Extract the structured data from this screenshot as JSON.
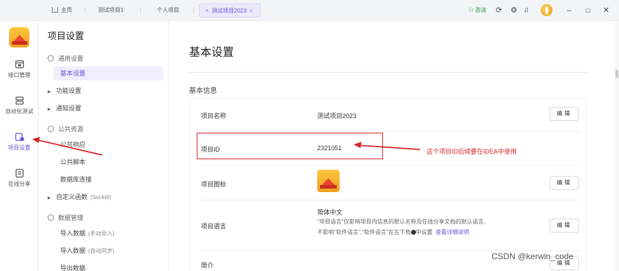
{
  "tabs": [
    {
      "label": "主页"
    },
    {
      "label": "测试项目1"
    },
    {
      "label": "个人项目"
    },
    {
      "label": "测试项目2023"
    }
  ],
  "topbar": {
    "invite": "邀请"
  },
  "rail": [
    {
      "label": "接口管理"
    },
    {
      "label": "自动化测试"
    },
    {
      "label": "项目设置"
    },
    {
      "label": "在线分享"
    }
  ],
  "nav": {
    "title": "项目设置",
    "general": "通用设置",
    "basic": "基本设置",
    "feature": "功能设置",
    "notify": "通知设置",
    "public": "公共资源",
    "public_response": "公共响应",
    "public_script": "公共脚本",
    "db_conn": "数据库连接",
    "custom_func": "自定义函数",
    "custom_func_sub": "(Socket)",
    "data_mgmt": "数据管理",
    "import_manual": "导入数据",
    "import_manual_sub": "(手动导入)",
    "import_auto": "导入数据",
    "import_auto_sub": "(自动同步)",
    "export": "导出数据"
  },
  "main": {
    "title": "基本设置",
    "section": "基本信息",
    "rows": {
      "name_label": "项目名称",
      "name_value": "测试项目2023",
      "id_label": "项目ID",
      "id_value": "2321051",
      "icon_label": "项目图标",
      "lang_label": "项目语言",
      "lang_value": "简体中文",
      "lang_desc_1": "\"项目语言\"仅影响项目内信息的默认名称及在线分享文档的默认语言,",
      "lang_desc_2": "不影响\"软件语言\",\"软件语言\"在左下角",
      "lang_desc_3": "中设置",
      "lang_link": "查看详细说明",
      "intro_label": "简介"
    },
    "edit_label": "编辑"
  },
  "annotation": {
    "text": "这个项目ID后续要在IDEA中使用"
  },
  "watermark": "CSDN @kerwin_code",
  "colors": {
    "accent": "#6a55d9",
    "annotation": "#d9262c",
    "invite": "#3ca665"
  }
}
